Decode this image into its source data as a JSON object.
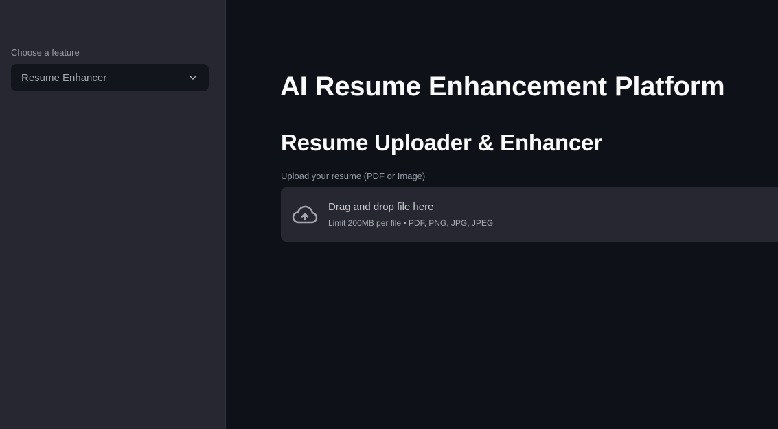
{
  "sidebar": {
    "select_label": "Choose a feature",
    "selected_value": "Resume Enhancer",
    "chevron_icon": "chevron-down-icon"
  },
  "main": {
    "title": "AI Resume Enhancement Platform",
    "section_title": "Resume Uploader & Enhancer",
    "uploader": {
      "label": "Upload your resume (PDF or Image)",
      "drop_text": "Drag and drop file here",
      "limit_text": "Limit 200MB per file • PDF, PNG, JPG, JPEG",
      "icon": "cloud-upload-icon"
    }
  },
  "colors": {
    "sidebar_bg": "#262730",
    "main_bg": "#0e1117",
    "select_bg": "#13151c",
    "dropzone_bg": "#262730",
    "title_text": "#fafafa",
    "muted_text": "#9a9ca6"
  }
}
